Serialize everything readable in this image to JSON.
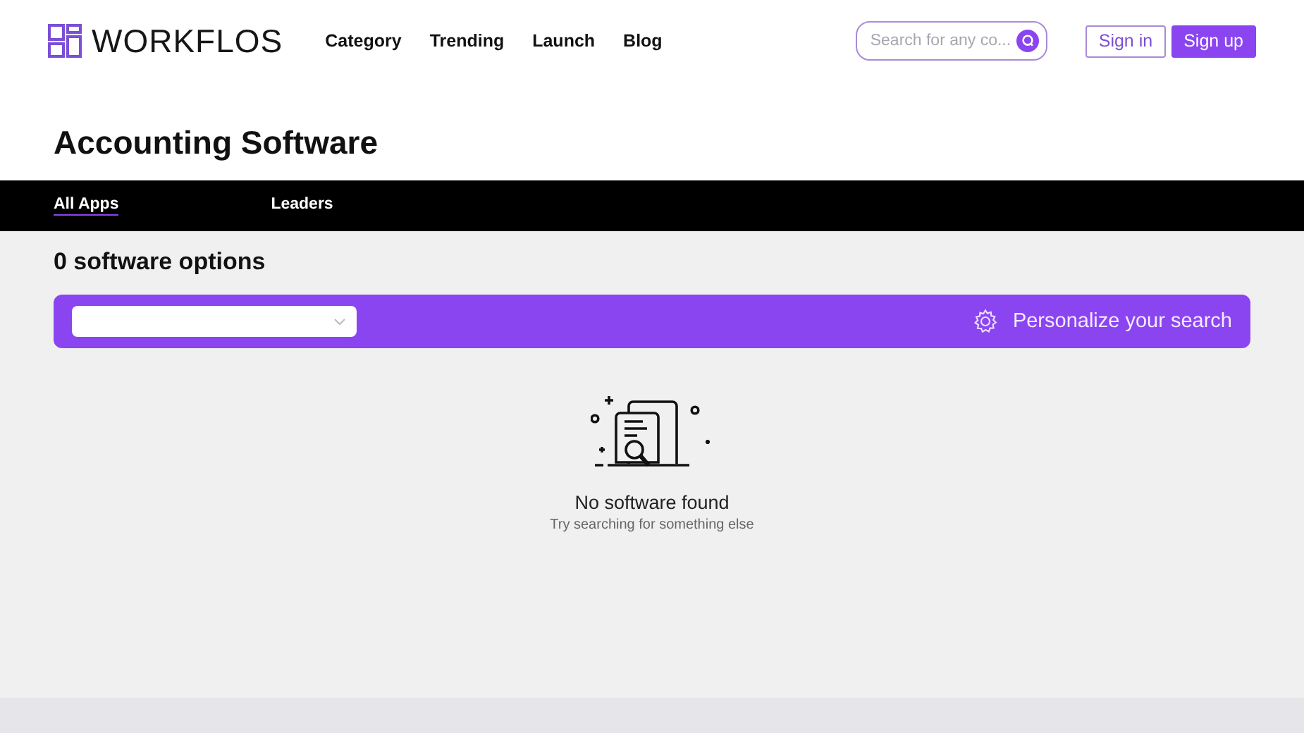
{
  "brand": {
    "name": "WORKFLOS"
  },
  "nav": [
    "Category",
    "Trending",
    "Launch",
    "Blog"
  ],
  "search": {
    "placeholder": "Search for any co..."
  },
  "auth_buttons": [
    {
      "label": "Sign in",
      "kind": "outline"
    },
    {
      "label": "Sign up",
      "kind": "filled"
    }
  ],
  "page_title": "Accounting Software",
  "tabs": [
    {
      "label": "All Apps",
      "selected": true
    },
    {
      "label": "Leaders",
      "selected": false
    }
  ],
  "result_count": "0 software options",
  "filter_bar": {
    "personalize": "Personalize your search"
  },
  "empty_state": {
    "title": "No software found",
    "subtitle": "Try searching for something else"
  }
}
